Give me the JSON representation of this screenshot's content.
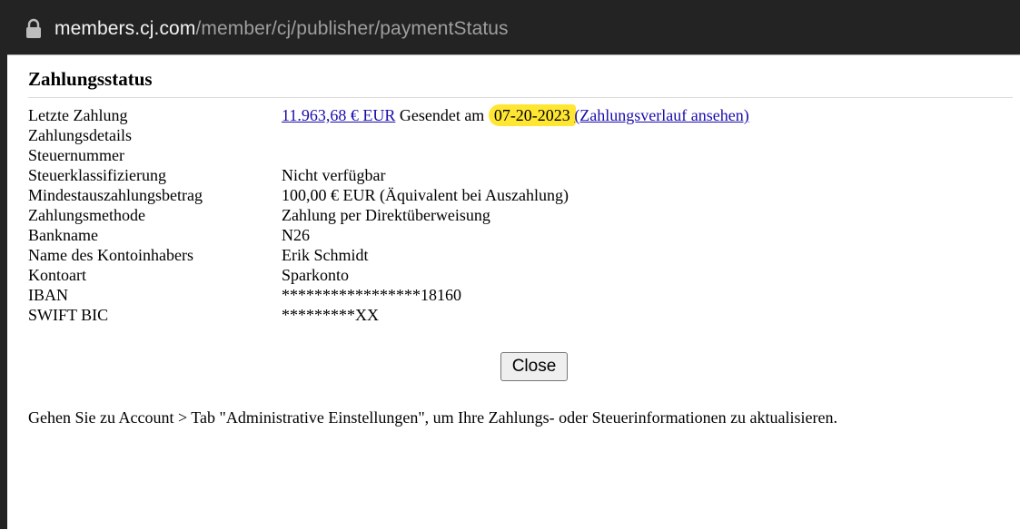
{
  "browser": {
    "url_domain": "members.cj.com",
    "url_path": "/member/cj/publisher/paymentStatus"
  },
  "page": {
    "title": "Zahlungsstatus",
    "last_payment": {
      "label": "Letzte Zahlung",
      "amount": "11.963,68 € EUR",
      "sent_text": " Gesendet am ",
      "date": "07-20-2023",
      "history_link": "(Zahlungsverlauf ansehen)"
    },
    "details": [
      {
        "label": "Zahlungsdetails",
        "value": ""
      },
      {
        "label": "Steuernummer",
        "value": ""
      },
      {
        "label": "Steuerklassifizierung",
        "value": "Nicht verfügbar"
      },
      {
        "label": "Mindestauszahlungsbetrag",
        "value": "100,00 € EUR (Äquivalent bei Auszahlung)"
      },
      {
        "label": "Zahlungsmethode",
        "value": "Zahlung per Direktüberweisung"
      },
      {
        "label": "Bankname",
        "value": "N26"
      },
      {
        "label": "Name des Kontoinhabers",
        "value": "Erik Schmidt"
      },
      {
        "label": "Kontoart",
        "value": "Sparkonto"
      },
      {
        "label": "IBAN",
        "value": "*****************18160"
      },
      {
        "label": "SWIFT BIC",
        "value": "*********XX"
      }
    ],
    "close_label": "Close",
    "footer": "Gehen Sie zu Account > Tab \"Administrative Einstellungen\", um Ihre Zahlungs- oder Steuerinformationen zu aktualisieren."
  },
  "colors": {
    "link": "#1a0dab",
    "highlight": "#ffe633",
    "browser_bar": "#232323"
  }
}
